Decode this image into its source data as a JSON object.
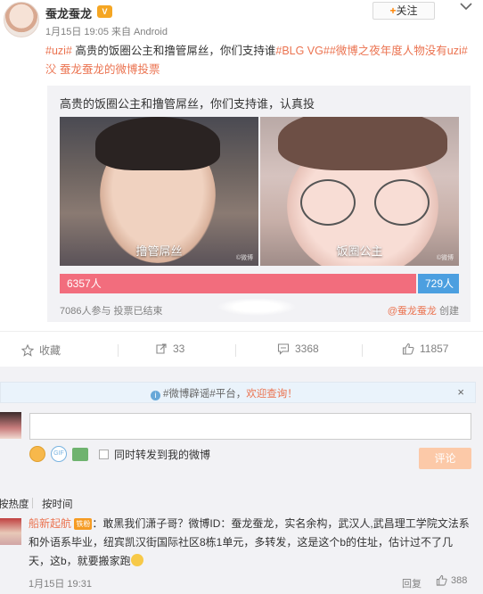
{
  "post": {
    "author": "蚕龙蚕龙",
    "meta": "1月15日 19:05 来自 Android",
    "follow_label": "关注",
    "text_tag1": "#uzi#",
    "text_main": " 高贵的饭圈公主和撸管屌丝，你们支持谁",
    "text_tag2": "#BLG VG#",
    "text_tag3": "#微博之夜年度人物没有uzi#",
    "text_link": "蚕龙蚕龙的微博投票"
  },
  "vote": {
    "title": "高贵的饭圈公主和撸管屌丝，你们支持谁，认真投",
    "options": [
      {
        "label": "撸管屌丝",
        "votes_label": "6357人",
        "votes": 6357,
        "color": "#f26d7d"
      },
      {
        "label": "饭圈公主",
        "votes_label": "729人",
        "votes": 729,
        "color": "#4c9fe0"
      }
    ],
    "status": "7086人参与  投票已结束",
    "creator": "@蚕龙蚕龙",
    "creator_suffix": " 创建"
  },
  "actions": {
    "favorite": "收藏",
    "repost": "33",
    "comment": "3368",
    "like": "11857"
  },
  "notice": {
    "prefix": "#微博辟谣#平台，",
    "highlight": "欢迎查询！",
    "close": "×"
  },
  "composer": {
    "placeholder": "",
    "sync_label": "同时转发到我的微博",
    "submit_label": "评论"
  },
  "sort": {
    "hot": "按热度",
    "time": "按时间"
  },
  "comment": {
    "user": "船新起航",
    "badge": "铁粉",
    "text": "：敢黑我们潇子哥？微博ID：蚕龙蚕龙，实名余构，武汉人,武昌理工学院文法系和外语系毕业，纽宾凯汉街国际社区8栋1单元，多转发，这是这个b的住址，估计过不了几天，这b，就要搬家跑",
    "time": "1月15日 19:31",
    "reply": "回复",
    "likes": "388"
  }
}
